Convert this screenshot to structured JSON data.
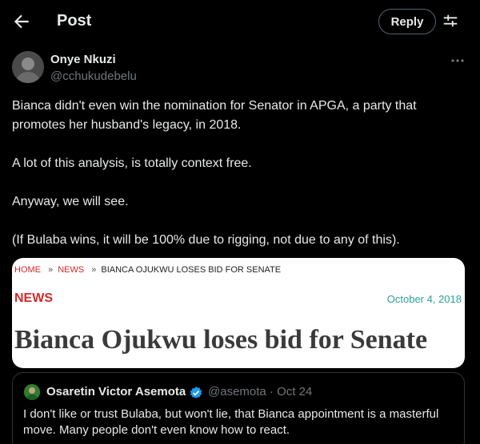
{
  "header": {
    "title": "Post",
    "reply_label": "Reply",
    "back_icon": "arrow-left-icon",
    "adjust_icon": "sliders-icon"
  },
  "author": {
    "name": "Onye Nkuzi",
    "handle": "@cchukudebelu"
  },
  "post": {
    "paragraphs": [
      "Bianca didn't even win the nomination for Senator in APGA, a party that promotes her husband's legacy, in 2018.",
      "A lot of this analysis, is totally context free.",
      "Anyway, we will see.",
      "(If Bulaba wins, it will be 100% due to rigging, not due to any of this)."
    ]
  },
  "media": {
    "breadcrumb": {
      "home": "HOME",
      "news": "NEWS",
      "sep1": "»",
      "sep2": "»",
      "current": "BIANCA OJUKWU LOSES BID FOR SENATE"
    },
    "section": "NEWS",
    "date": "October 4, 2018",
    "headline": "Bianca Ojukwu loses bid for Senate"
  },
  "quoted": {
    "name": "Osaretin Victor Asemota",
    "handle_date": "@asemota · Oct 24",
    "text": "I don't like or trust Bulaba, but won't lie, that Bianca appointment is a masterful move. Many people don't even know how to react."
  },
  "colors": {
    "background": "#000000",
    "text": "#e7e9ea",
    "muted": "#71767b",
    "verified": "#1d9bf0",
    "news_red": "#d22a2a",
    "date_teal": "#2aa198"
  }
}
